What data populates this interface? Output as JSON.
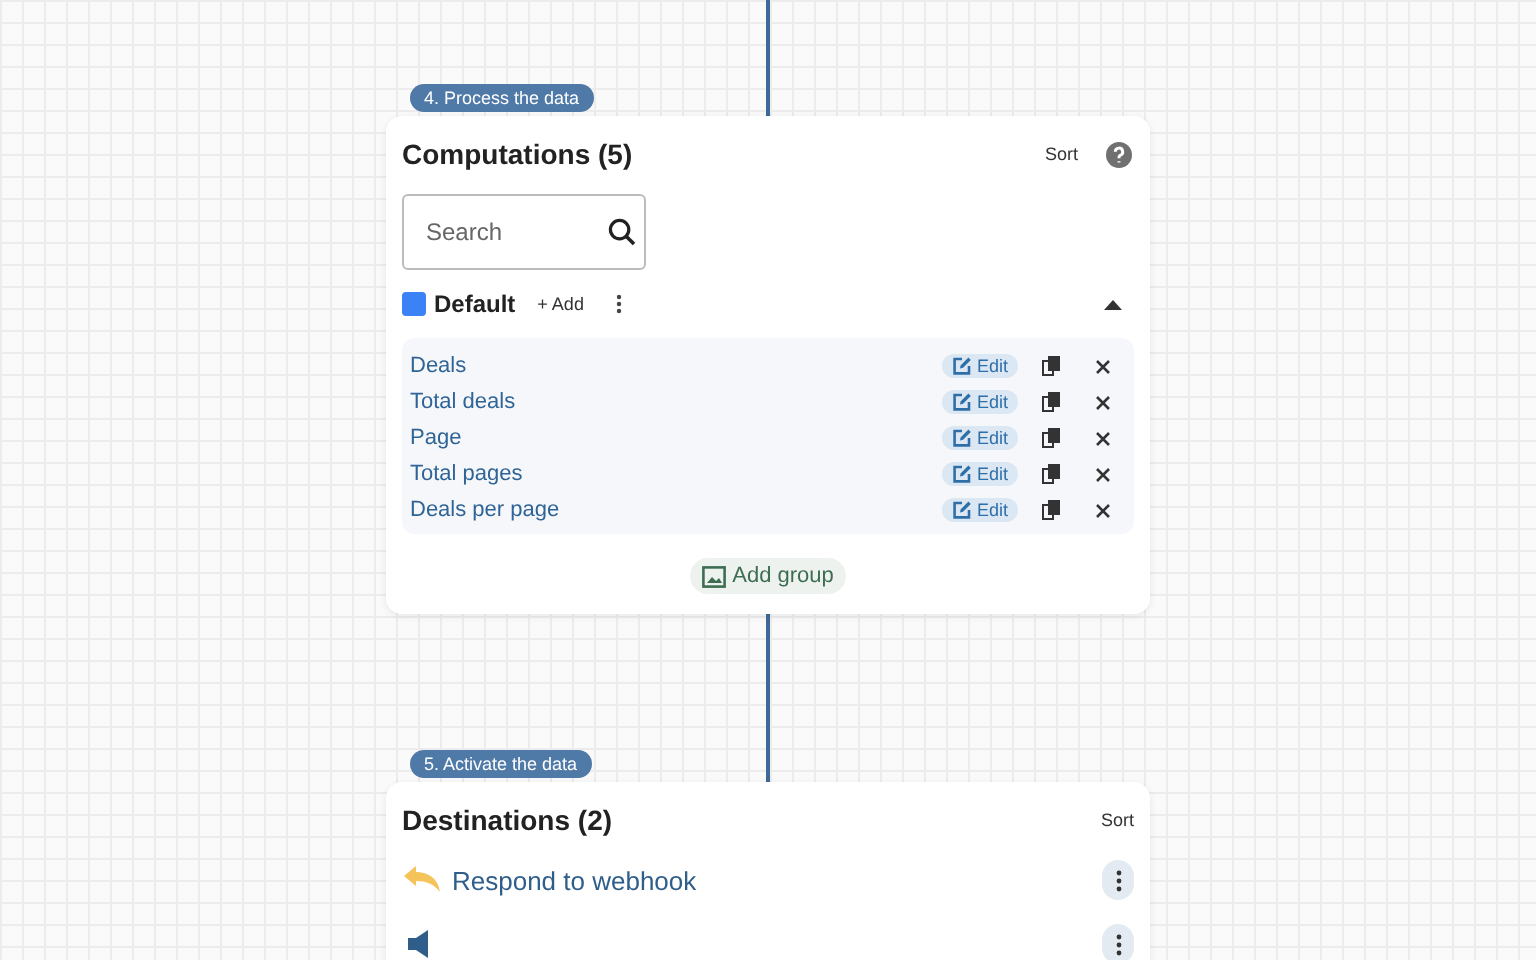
{
  "sections": [
    {
      "step": "4. Process the data",
      "title": "Computations (5)",
      "sort": "Sort",
      "help": true,
      "search": {
        "placeholder": "Search"
      },
      "group": {
        "name": "Default",
        "color": "#3b82f6",
        "add": "+ Add",
        "expanded": true,
        "items": [
          {
            "label": "Deals",
            "edit": "Edit"
          },
          {
            "label": "Total deals",
            "edit": "Edit"
          },
          {
            "label": "Page",
            "edit": "Edit"
          },
          {
            "label": "Total pages",
            "edit": "Edit"
          },
          {
            "label": "Deals per page",
            "edit": "Edit"
          }
        ]
      },
      "add_group": "Add group"
    },
    {
      "step": "5. Activate the data",
      "title": "Destinations (2)",
      "sort": "Sort",
      "destinations": [
        {
          "kind": "webhook",
          "label": "Respond to webhook"
        },
        {
          "kind": "list"
        }
      ]
    }
  ]
}
